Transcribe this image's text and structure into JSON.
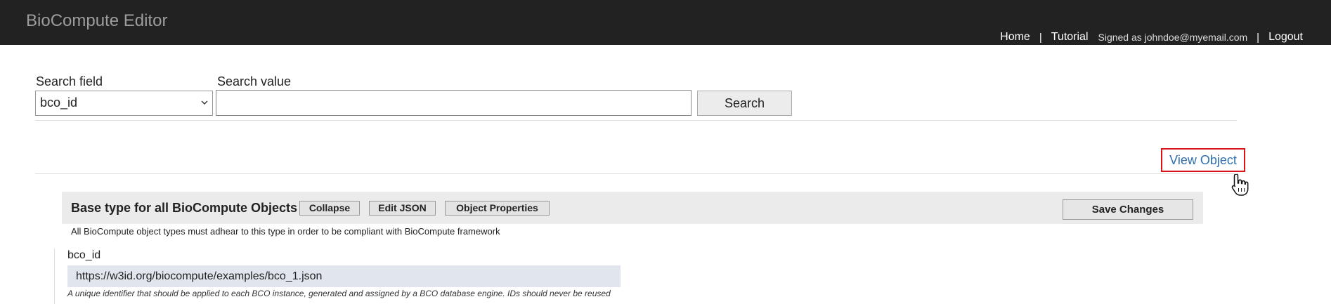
{
  "app": {
    "title": "BioCompute Editor"
  },
  "nav": {
    "home": "Home",
    "tutorial": "Tutorial",
    "signed_as": "Signed as johndoe@myemail.com",
    "logout": "Logout",
    "separator": "|"
  },
  "search": {
    "field_label": "Search field",
    "field_value": "bco_id",
    "value_label": "Search value",
    "value_input": "",
    "button": "Search"
  },
  "view_object": {
    "label": "View Object",
    "highlight_color": "#d9141c"
  },
  "schema": {
    "title": "Base type for all BioCompute Objects",
    "collapse": "Collapse",
    "edit_json": "Edit JSON",
    "object_properties": "Object Properties",
    "save_changes": "Save Changes",
    "description": "All BioCompute object types must adhear to this type in order to be compliant with BioCompute framework"
  },
  "fields": [
    {
      "name": "bco_id",
      "value": "https://w3id.org/biocompute/examples/bco_1.json",
      "help": "A unique identifier that should be applied to each BCO instance, generated and assigned by a BCO database engine. IDs should never be reused"
    }
  ],
  "icons": {
    "select_caret": "chevron-down-icon",
    "pointer": "hand-pointer-icon"
  },
  "colors": {
    "topbar": "#222222",
    "link": "#2f6fb0",
    "field_bg": "#e1e6ee"
  }
}
